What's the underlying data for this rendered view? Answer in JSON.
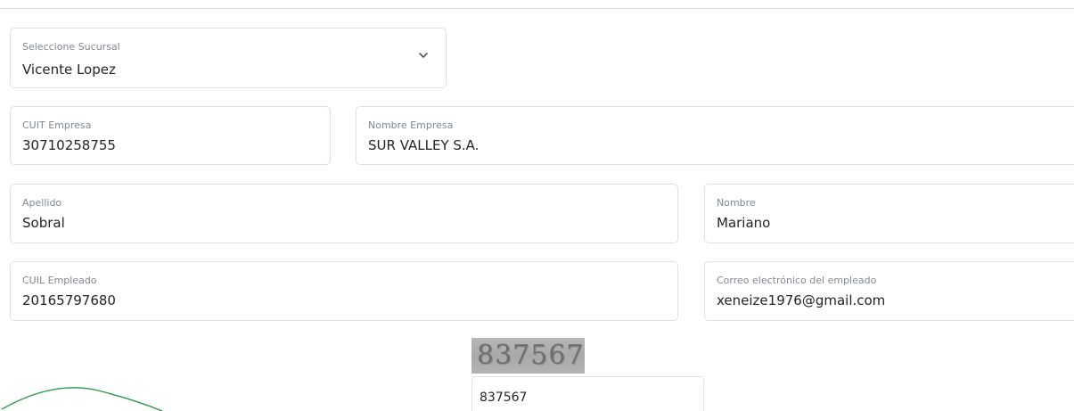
{
  "sucursal": {
    "label": "Seleccione Sucursal",
    "value": "Vicente Lopez"
  },
  "cuit_empresa": {
    "label": "CUIT Empresa",
    "value": "30710258755"
  },
  "nombre_empresa": {
    "label": "Nombre Empresa",
    "value": "SUR VALLEY S.A."
  },
  "apellido": {
    "label": "Apellido",
    "value": "Sobral"
  },
  "nombre": {
    "label": "Nombre",
    "value": "Mariano"
  },
  "cuil_empleado": {
    "label": "CUIL Empleado",
    "value": "20165797680"
  },
  "correo": {
    "label": "Correo electrónico del empleado",
    "value": "xeneize1976@gmail.com"
  },
  "captcha": {
    "image_text": "837567",
    "input_value": "837567"
  },
  "colors": {
    "border": "#dee2e6",
    "label": "#808890",
    "text": "#212529",
    "spinner": "#2e9a4e"
  },
  "icons": {
    "select_chevron": "chevron-down-icon"
  }
}
